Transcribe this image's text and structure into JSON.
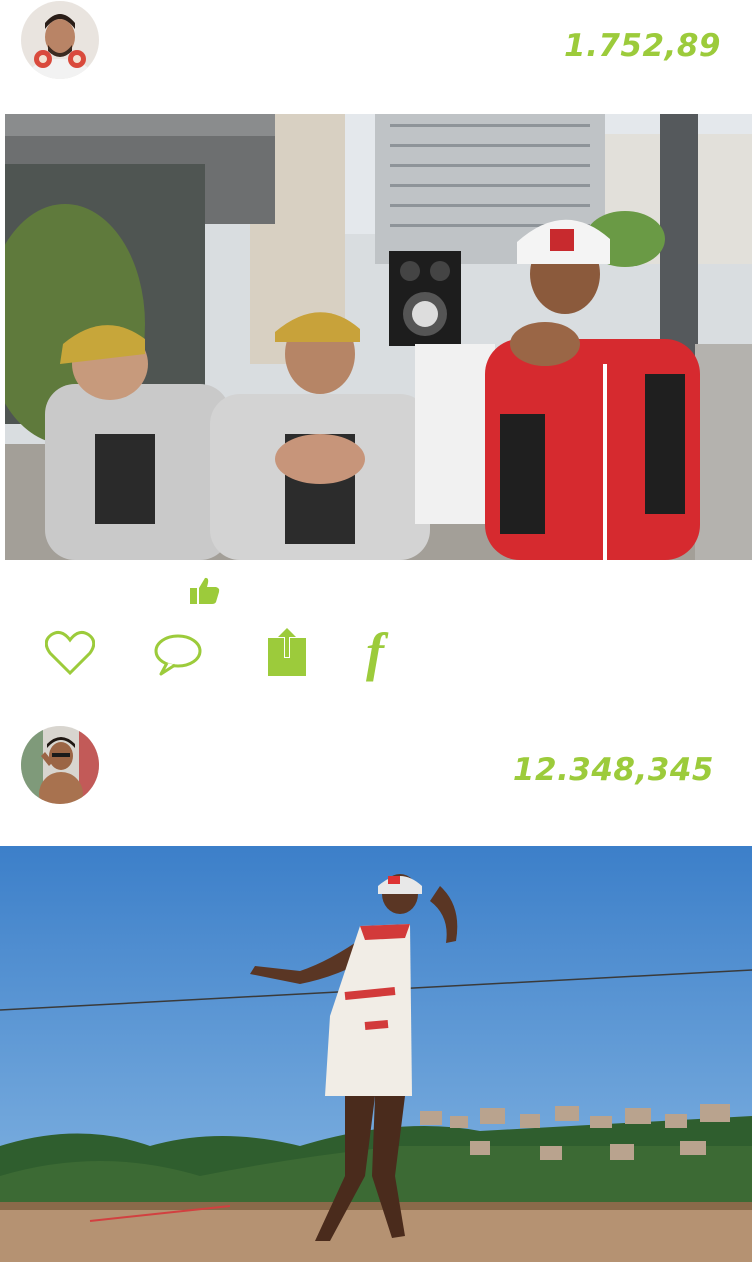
{
  "theme": {
    "accent": "#9ccb3b"
  },
  "feed": {
    "post1": {
      "avatar": "man-with-headphones-avatar",
      "score": "1.752,89",
      "photo": "street-dancers-with-speaker-photo",
      "like_badge_icon": "thumbs-up-icon"
    },
    "actions": {
      "like_icon": "heart-icon",
      "comment_icon": "comment-bubble-icon",
      "share_icon": "share-upload-icon",
      "facebook_icon": "facebook-f-icon",
      "facebook_glyph": "f"
    },
    "post2": {
      "avatar": "shirtless-man-avatar",
      "score": "12.348,345",
      "photo": "dancer-on-hilltop-photo"
    }
  }
}
